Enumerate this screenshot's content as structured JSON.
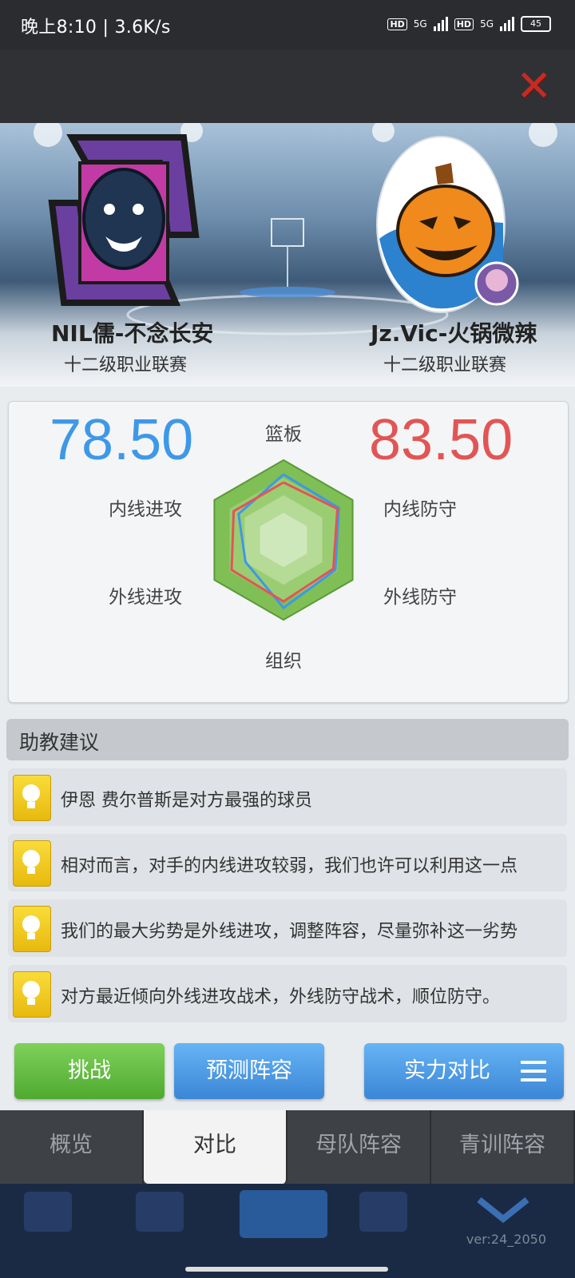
{
  "status": {
    "time": "晚上8:10 | 3.6K/s",
    "battery": "45",
    "network": "5G",
    "hd": "HD"
  },
  "header": {
    "close_icon": "close-icon"
  },
  "teams": {
    "home": {
      "name": "NIL儒-不念长安",
      "league": "十二级职业联赛",
      "score": "78.50",
      "color": "#3e98e8"
    },
    "away": {
      "name": "Jz.Vic-火锅微辣",
      "league": "十二级职业联赛",
      "score": "83.50",
      "color": "#e25555"
    }
  },
  "radar": {
    "labels": {
      "top": "篮板",
      "upper_left": "内线进攻",
      "upper_right": "内线防守",
      "lower_left": "外线进攻",
      "lower_right": "外线防守",
      "bottom": "组织"
    },
    "axes_order": [
      "篮板",
      "内线防守",
      "外线防守",
      "组织",
      "外线进攻",
      "内线进攻"
    ],
    "home_values": [
      0.82,
      0.8,
      0.75,
      0.85,
      0.55,
      0.65
    ],
    "away_values": [
      0.72,
      0.78,
      0.72,
      0.77,
      0.75,
      0.72
    ]
  },
  "advice": {
    "title": "助教建议",
    "items": [
      "伊恩 费尔普斯是对方最强的球员",
      "相对而言，对手的内线进攻较弱，我们也许可以利用这一点",
      "我们的最大劣势是外线进攻，调整阵容，尽量弥补这一劣势",
      "对方最近倾向外线进攻战术，外线防守战术，顺位防守。"
    ]
  },
  "actions": {
    "challenge": "挑战",
    "predict": "预测阵容",
    "compare": "实力对比"
  },
  "tabs": [
    "概览",
    "对比",
    "母队阵容",
    "青训阵容"
  ],
  "active_tab": "对比",
  "version": "ver:24_2050"
}
